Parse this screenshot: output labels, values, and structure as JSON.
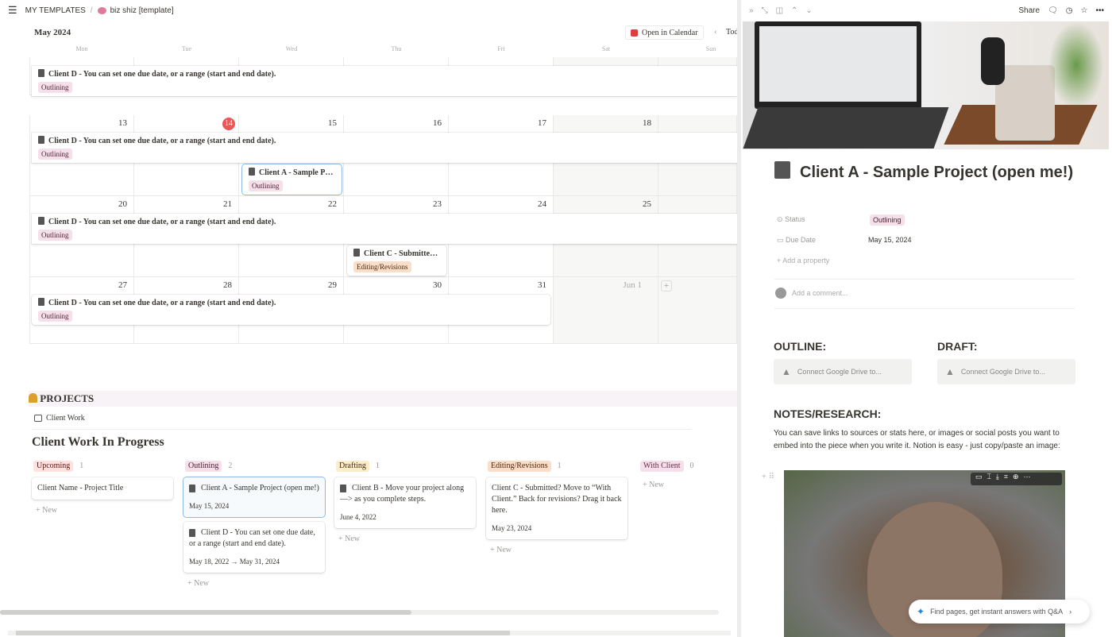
{
  "breadcrumb": {
    "workspace": "MY TEMPLATES",
    "separator": "/",
    "page": "biz shiz [template]"
  },
  "calendar": {
    "month": "May 2024",
    "open_in_calendar": "Open in Calendar",
    "today": "Today",
    "weekdays": [
      "Mon",
      "Tue",
      "Wed",
      "Thu",
      "Fri",
      "Sat",
      "Sun"
    ],
    "weeks": [
      {
        "days": [
          "",
          "",
          "",
          "",
          "",
          "",
          ""
        ]
      },
      {
        "days": [
          "13",
          "14",
          "15",
          "16",
          "17",
          "18",
          ""
        ]
      },
      {
        "days": [
          "20",
          "21",
          "22",
          "23",
          "24",
          "25",
          ""
        ]
      },
      {
        "days": [
          "27",
          "28",
          "29",
          "30",
          "31",
          "Jun 1",
          ""
        ]
      }
    ],
    "today_day": "14",
    "events": {
      "client_d": "Client D - You can set one due date, or a range (start and end date).",
      "client_a": "Client A - Sample Proj...",
      "client_c": "Client C - Submitted? M...",
      "outlining": "Outlining",
      "editing": "Editing/Revisions"
    }
  },
  "projects": {
    "heading": "PROJECTS",
    "view_tab": "Client Work",
    "board_title": "Client Work In Progress",
    "new_label": "New",
    "columns": [
      {
        "label": "Upcoming",
        "count": "1",
        "cards": [
          {
            "title": "Client Name - Project Title"
          }
        ]
      },
      {
        "label": "Outlining",
        "count": "2",
        "cards": [
          {
            "title": "Client A - Sample Project (open me!)",
            "date": "May 15, 2024"
          },
          {
            "title": "Client D - You can set one due date, or a range (start and end date).",
            "date": "May 18, 2022 → May 31, 2024"
          }
        ]
      },
      {
        "label": "Drafting",
        "count": "1",
        "cards": [
          {
            "title": "Client B - Move your project along —> as you complete steps.",
            "date": "June 4, 2022"
          }
        ]
      },
      {
        "label": "Editing/Revisions",
        "count": "1",
        "cards": [
          {
            "title": "Client C - Submitted? Move to “With Client.” Back for revisions? Drag it back here.",
            "date": "May 23, 2024"
          }
        ]
      },
      {
        "label": "With Client",
        "count": "0",
        "cards": []
      }
    ]
  },
  "peek": {
    "share": "Share",
    "title": "Client A - Sample Project (open me!)",
    "props": [
      {
        "name": "Status",
        "value": "Outlining"
      },
      {
        "name": "Due Date",
        "value": "May 15, 2024"
      }
    ],
    "add_property": "Add a property",
    "add_comment": "Add a comment...",
    "outline_h": "OUTLINE:",
    "draft_h": "DRAFT:",
    "gdrive": "Connect Google Drive to...",
    "notes_h": "NOTES/RESEARCH:",
    "notes_text": "You can save links to sources or stats here, or images or social posts you want to embed into the piece when you write it. Notion is easy - just copy/paste an image:",
    "qa": "Find pages, get instant answers with Q&A"
  }
}
